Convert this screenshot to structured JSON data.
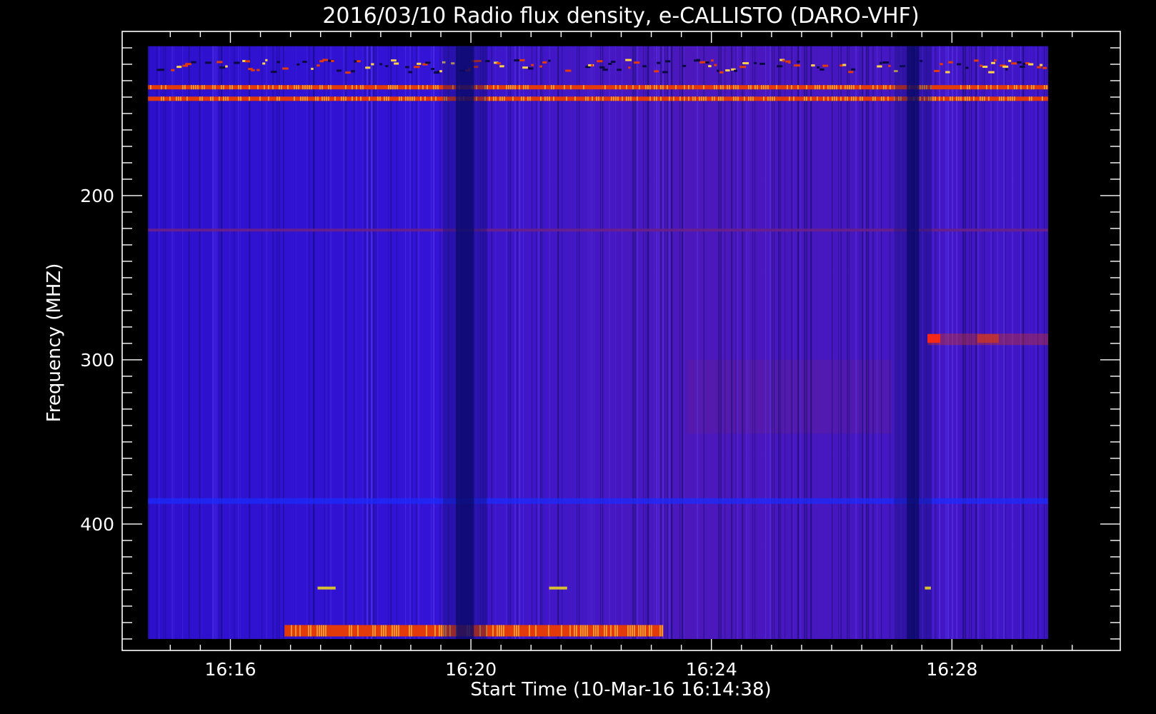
{
  "chart_data": {
    "type": "heatmap",
    "title": "2016/03/10  Radio flux density, e-CALLISTO (DARO-VHF)",
    "xlabel": "Start Time (10-Mar-16 16:14:38)",
    "ylabel": "Frequency (MHZ)",
    "x_range_minutes": [
      14.2,
      30.8
    ],
    "data_x_range_minutes": [
      14.63,
      29.6
    ],
    "y_range_mhz": [
      100,
      477
    ],
    "data_y_range_mhz": [
      109,
      470
    ],
    "y_reversed": true,
    "x_ticks": [
      {
        "value": 16,
        "label": "16:16"
      },
      {
        "value": 20,
        "label": "16:20"
      },
      {
        "value": 24,
        "label": "16:24"
      },
      {
        "value": 28,
        "label": "16:28"
      }
    ],
    "y_ticks": [
      {
        "value": 200,
        "label": "200"
      },
      {
        "value": 300,
        "label": "300"
      },
      {
        "value": 400,
        "label": "400"
      }
    ],
    "grid": false,
    "background_color": "#000000",
    "axis_color": "#ffffff",
    "colors": {
      "background_field": "#3312d8",
      "low_band": "#0a0a66",
      "medium": "#6c1f8a",
      "hot": "#e23a0a",
      "peak": "#ffd24a"
    },
    "features": [
      {
        "type": "horizontal_band",
        "freq_mhz": 134,
        "intensity": "hot",
        "x_range_minutes": [
          14.63,
          29.6
        ]
      },
      {
        "type": "horizontal_band",
        "freq_mhz": 141,
        "intensity": "hot",
        "x_range_minutes": [
          14.63,
          29.6
        ]
      },
      {
        "type": "horizontal_band",
        "freq_mhz": 121,
        "intensity": "mixed",
        "x_range_minutes": [
          14.63,
          29.6
        ]
      },
      {
        "type": "horizontal_band",
        "freq_mhz": 221,
        "intensity": "medium",
        "x_range_minutes": [
          14.63,
          29.6
        ]
      },
      {
        "type": "horizontal_band",
        "freq_mhz": 386,
        "intensity": "low",
        "x_range_minutes": [
          14.63,
          29.6
        ]
      },
      {
        "type": "horizontal_band",
        "freq_mhz": 465,
        "intensity": "hot",
        "x_range_minutes": [
          16.9,
          23.2
        ]
      },
      {
        "type": "dark_column",
        "x_range_minutes": [
          19.75,
          20.05
        ]
      },
      {
        "type": "dark_column",
        "x_range_minutes": [
          27.25,
          27.45
        ]
      },
      {
        "type": "burst_patch",
        "x_minutes": 27.7,
        "freq_mhz": 287,
        "intensity": "hot"
      },
      {
        "type": "burst_patch",
        "x_minutes": 28.6,
        "freq_mhz": 287,
        "intensity": "medium"
      }
    ]
  }
}
